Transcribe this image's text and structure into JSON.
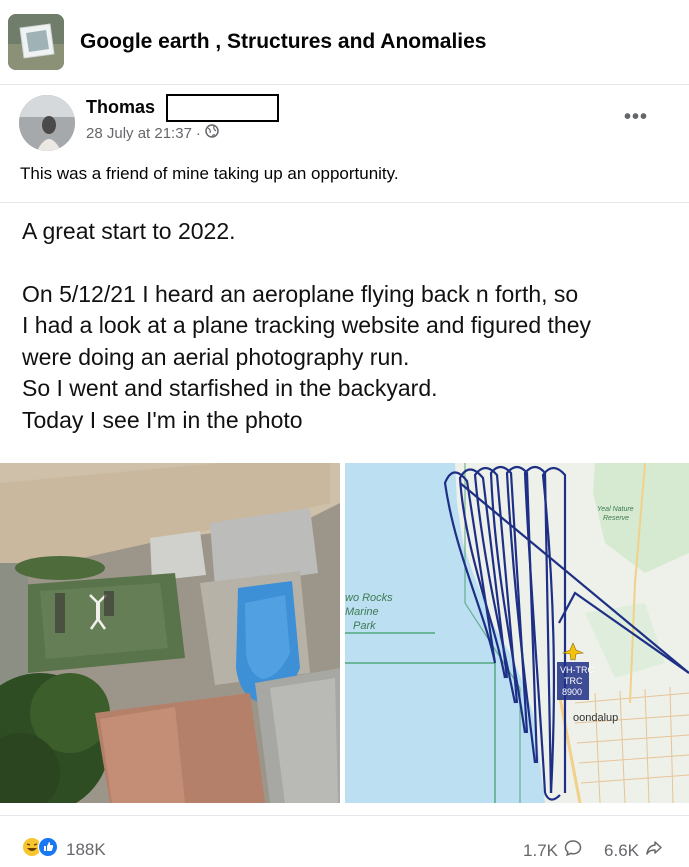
{
  "group": {
    "name": "Google earth , Structures and Anomalies"
  },
  "post": {
    "author": "Thomas",
    "timestamp": "28 July at 21:37",
    "separator": "·",
    "caption": "This was a friend of mine taking up an opportunity.",
    "story_lines": [
      "A great start to 2022.",
      "",
      "On 5/12/21 I heard an aeroplane flying back n forth, so",
      "I had a look at a plane tracking website and figured they",
      "were doing an aerial photography run.",
      "So I went and starfished in the backyard.",
      "Today I see I'm in the photo"
    ]
  },
  "map": {
    "labels": {
      "park_line1": "wo Rocks",
      "park_line2": "Marine",
      "park_line3": "Park",
      "reserve_line1": "Yeal Nature",
      "reserve_line2": "Reserve",
      "callsign_line1": "VH-TRC",
      "callsign_line2": "TRC",
      "callsign_line3": "8900",
      "town": "oondalup"
    }
  },
  "engagement": {
    "reactions_count": "188K",
    "comments_count": "1.7K",
    "shares_count": "6.6K"
  },
  "colors": {
    "track": "#1e2f86",
    "sea": "#bcdff2",
    "land": "#eef0ea",
    "muted_text": "#65676b"
  }
}
